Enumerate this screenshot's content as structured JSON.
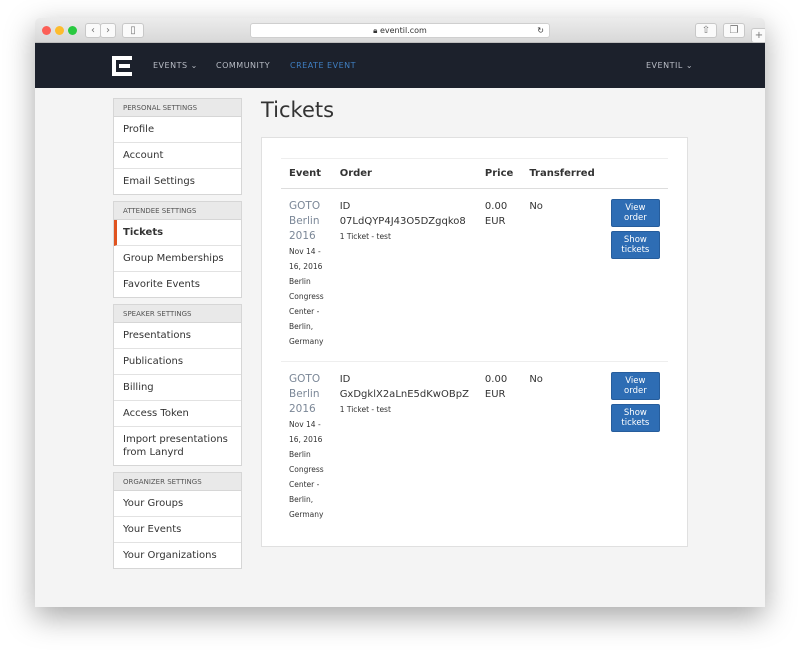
{
  "browser": {
    "url": "eventil.com"
  },
  "nav": {
    "events": "EVENTS ⌄",
    "community": "COMMUNITY",
    "create": "CREATE EVENT",
    "account": "EVENTIL ⌄",
    "accent": "#3f7fc2"
  },
  "sidebar": [
    {
      "header": "PERSONAL SETTINGS",
      "items": [
        "Profile",
        "Account",
        "Email Settings"
      ]
    },
    {
      "header": "ATTENDEE SETTINGS",
      "items": [
        "Tickets",
        "Group Memberships",
        "Favorite Events"
      ]
    },
    {
      "header": "SPEAKER SETTINGS",
      "items": [
        "Presentations",
        "Publications",
        "Billing",
        "Access Token",
        "Import presentations from Lanyrd"
      ]
    },
    {
      "header": "ORGANIZER SETTINGS",
      "items": [
        "Your Groups",
        "Your Events",
        "Your Organizations"
      ]
    }
  ],
  "active_item": "Tickets",
  "page_title": "Tickets",
  "table": {
    "headers": [
      "Event",
      "Order",
      "Price",
      "Transferred"
    ],
    "rows": [
      {
        "event": "GOTO Berlin 2016",
        "dates": "Nov 14 - 16, 2016",
        "venue": "Berlin Congress Center - Berlin, Germany",
        "order_id": "ID 07LdQYP4J43O5DZgqko8",
        "order_detail": "1 Ticket - test",
        "price": "0.00 EUR",
        "transferred": "No",
        "view": "View order",
        "show": "Show tickets"
      },
      {
        "event": "GOTO Berlin 2016",
        "dates": "Nov 14 - 16, 2016",
        "venue": "Berlin Congress Center - Berlin, Germany",
        "order_id": "ID GxDgklX2aLnE5dKwOBpZ",
        "order_detail": "1 Ticket - test",
        "price": "0.00 EUR",
        "transferred": "No",
        "view": "View order",
        "show": "Show tickets"
      }
    ]
  }
}
